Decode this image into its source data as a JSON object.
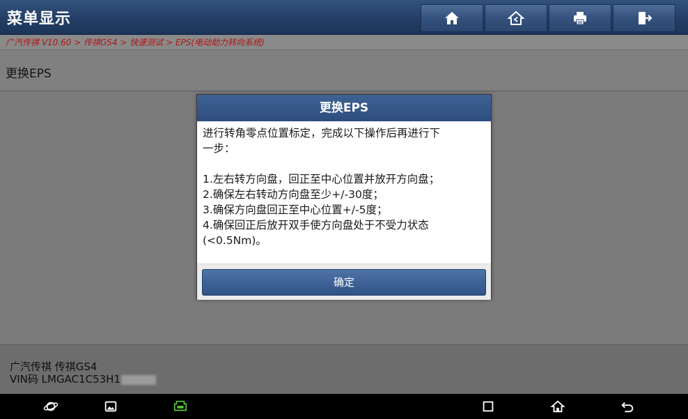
{
  "header": {
    "title": "菜单显示",
    "buttons": [
      {
        "name": "home-icon"
      },
      {
        "name": "back-home-icon"
      },
      {
        "name": "print-icon"
      },
      {
        "name": "exit-icon"
      }
    ]
  },
  "breadcrumb": "广汽传祺 V10.60 > 传祺GS4 > 快速测试 > EPS(电动助力转向系统)",
  "section_title": "更换EPS",
  "dialog": {
    "title": "更换EPS",
    "intro_line1": "进行转角零点位置标定，完成以下操作后再进行下",
    "intro_line2": "一步：",
    "steps": [
      "1.左右转方向盘，回正至中心位置并放开方向盘；",
      "2.确保左右转动方向盘至少+/-30度；",
      "3.确保方向盘回正至中心位置+/-5度；",
      "4.确保回正后放开双手使方向盘处于不受力状态",
      "(<0.5Nm)。"
    ],
    "ok_label": "确定"
  },
  "vehicle": {
    "model": "广汽传祺 传祺GS4",
    "vin": "VIN码 LMGAC1C53H1"
  },
  "colors": {
    "titlebar": "#243e66",
    "breadcrumb_text": "#b31515",
    "button_blue": "#2f5287",
    "vci_green": "#5cc93a"
  }
}
